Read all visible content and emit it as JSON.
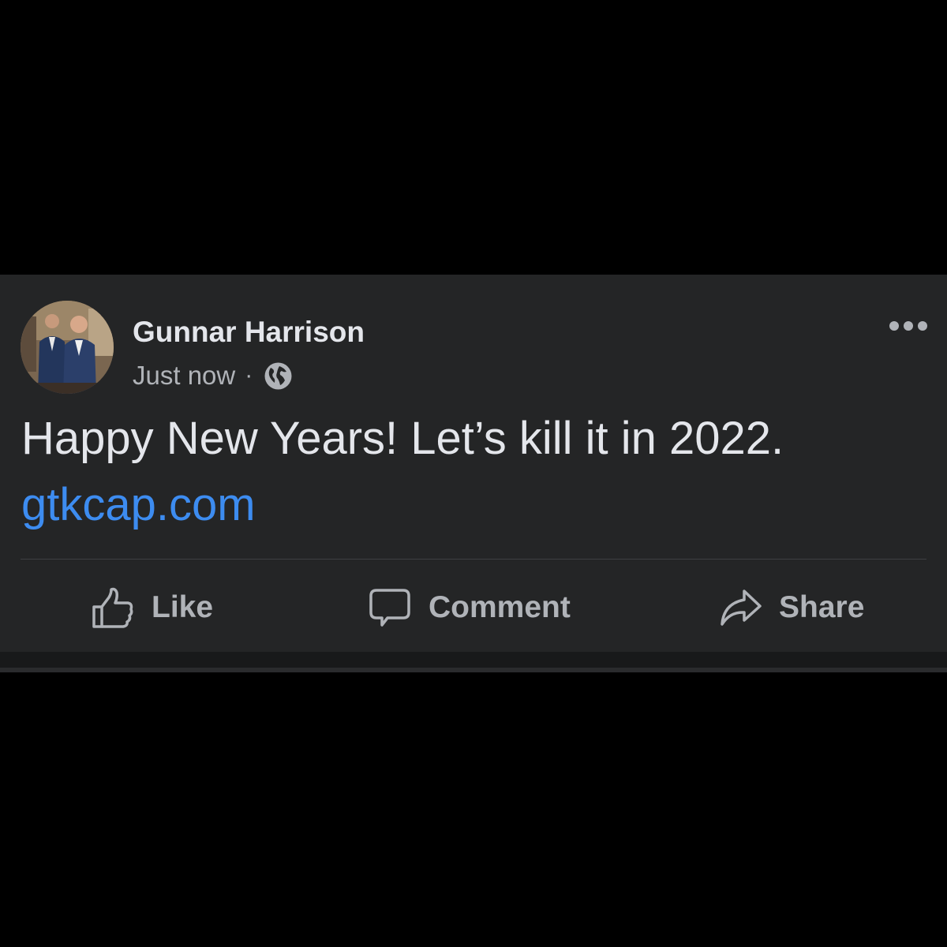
{
  "post": {
    "author_name": "Gunnar Harrison",
    "timestamp": "Just now",
    "separator": "·",
    "privacy_icon": "globe-icon",
    "text": "Happy New Years! Let’s kill it in 2022.",
    "link": "gtkcap.com",
    "more_icon": "more-options-icon"
  },
  "actions": {
    "like_label": "Like",
    "comment_label": "Comment",
    "share_label": "Share"
  },
  "colors": {
    "background": "#000000",
    "card": "#242526",
    "primary_text": "#e4e6eb",
    "secondary_text": "#b0b3b8",
    "link": "#3d8cf0"
  }
}
